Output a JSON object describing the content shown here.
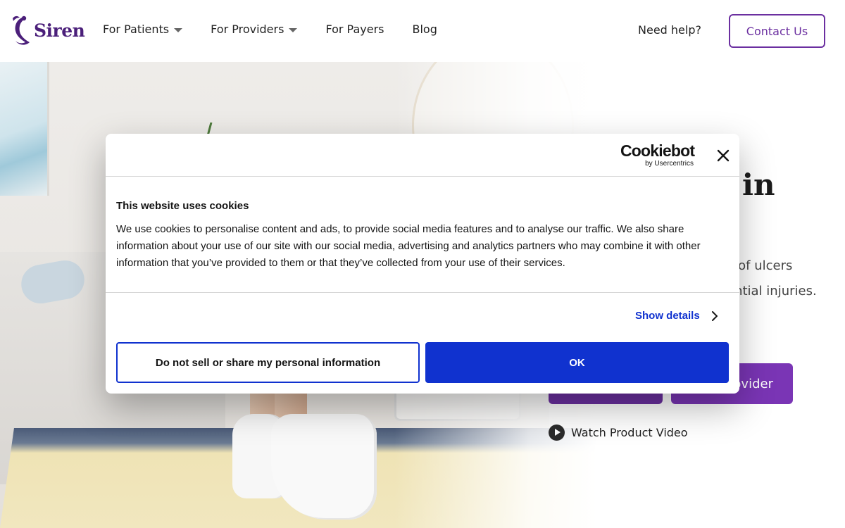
{
  "header": {
    "logo_text": "Siren",
    "nav": [
      {
        "label": "For Patients",
        "has_dropdown": true
      },
      {
        "label": "For Providers",
        "has_dropdown": true
      },
      {
        "label": "For Payers",
        "has_dropdown": false
      },
      {
        "label": "Blog",
        "has_dropdown": false
      }
    ],
    "need_help": "Need help?",
    "contact_label": "Contact Us"
  },
  "hero": {
    "headline_visible_fragment": "p in",
    "subtext_line1_fragment": "k of ulcers",
    "subtext_line2_fragment": "ential injuries.",
    "cta_primary_label": "",
    "cta_secondary_label_fragment": "ovider",
    "watch_label": "Watch Product Video"
  },
  "cookie_dialog": {
    "brand": "Cookiebot",
    "brand_sub": "by Usercentrics",
    "title": "This website uses cookies",
    "body": "We use cookies to personalise content and ads, to provide social media features and to analyse our traffic. We also share information about your use of our site with our social media, advertising and analytics partners who may combine it with other information that you’ve provided to them or that they’ve collected from your use of their services.",
    "show_details": "Show details",
    "deny_label": "Do not sell or share my personal information",
    "ok_label": "OK"
  },
  "colors": {
    "brand_purple": "#6b2fa0",
    "cookie_blue": "#1032cf",
    "text_dark": "#141414"
  }
}
